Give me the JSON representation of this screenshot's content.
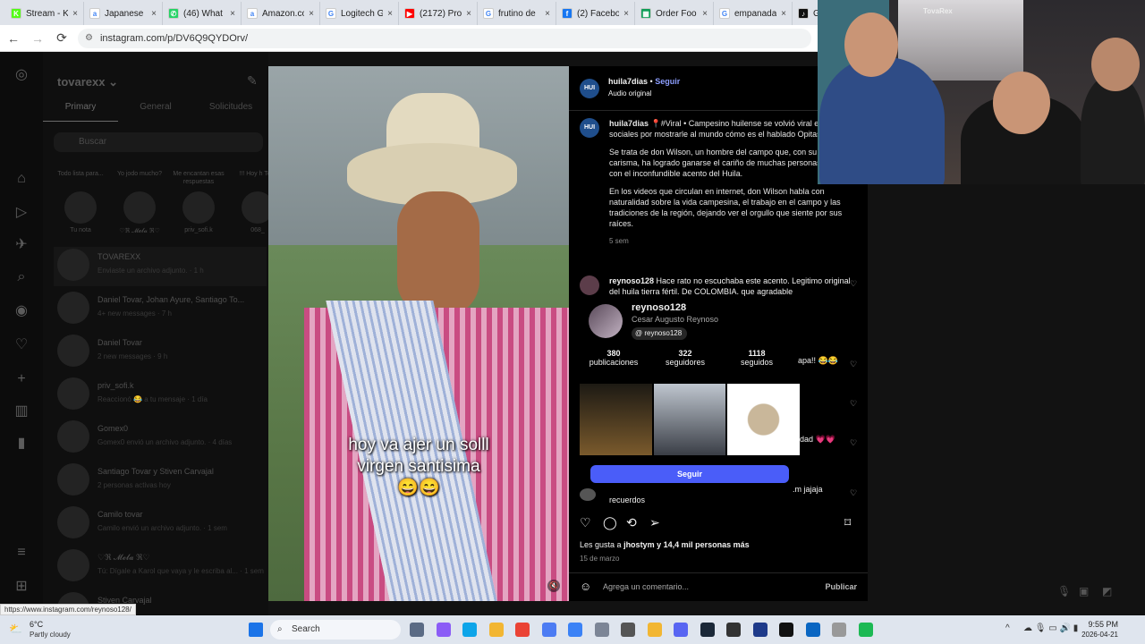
{
  "browser": {
    "tabs": [
      {
        "title": "Stream - K",
        "color": "#53fc18",
        "glyph": "K"
      },
      {
        "title": "Japanese",
        "color": "#ffffff",
        "glyph": "a"
      },
      {
        "title": "(46) What",
        "color": "#25d366",
        "glyph": "✆"
      },
      {
        "title": "Amazon.co",
        "color": "#ffffff",
        "glyph": "a"
      },
      {
        "title": "Logitech G",
        "color": "#ffffff",
        "glyph": "G"
      },
      {
        "title": "(2172) Pro",
        "color": "#ff0000",
        "glyph": "▶"
      },
      {
        "title": "frutino de",
        "color": "#ffffff",
        "glyph": "G"
      },
      {
        "title": "(2) Facebo",
        "color": "#1877f2",
        "glyph": "f"
      },
      {
        "title": "Order Foo",
        "color": "#0f9d58",
        "glyph": "▦"
      },
      {
        "title": "empanada",
        "color": "#ffffff",
        "glyph": "G"
      },
      {
        "title": "Gust",
        "color": "#111111",
        "glyph": "♪"
      }
    ],
    "url": "instagram.com/p/DV6Q9QYDOrv/",
    "status_url": "https://www.instagram.com/reynoso128/"
  },
  "dm": {
    "username": "tovarexx",
    "tabs": [
      "Primary",
      "General",
      "Solicitudes"
    ],
    "search_placeholder": "Buscar",
    "notes": [
      {
        "bubble": "Todo lista para...",
        "name": "Tu nota"
      },
      {
        "bubble": "Yo jodo mucho?",
        "name": "♡ℜ 𝓜𝓮𝓵𝓪 ℜ♡"
      },
      {
        "bubble": "Me encantan esas respuestas",
        "name": "priv_sofi.k"
      },
      {
        "bubble": "!!! Hoy h Tom",
        "name": "068_"
      }
    ],
    "threads": [
      {
        "name": "TOVAREXX",
        "sub": "Enviaste un archivo adjunto. · 1 h"
      },
      {
        "name": "Daniel Tovar, Johan Ayure, Santiago To...",
        "sub": "4+ new messages · 7 h"
      },
      {
        "name": "Daniel Tovar",
        "sub": "2 new messages · 9 h"
      },
      {
        "name": "priv_sofi.k",
        "sub": "Reaccionó 😂 a tu mensaje · 1 día"
      },
      {
        "name": "Gomex0",
        "sub": "Gomex0 envió un archivo adjunto. · 4 días"
      },
      {
        "name": "Santiago Tovar y Stiven Carvajal",
        "sub": "2 personas activas hoy"
      },
      {
        "name": "Camilo tovar",
        "sub": "Camilo envió un archivo adjunto. · 1 sem"
      },
      {
        "name": "♡ℜ 𝓜𝓮𝓵𝓪 ℜ♡",
        "sub": "Tú: Dígale a Karol que vaya y le escriba al... · 1 sem"
      },
      {
        "name": "Stiven Carvajal",
        "sub": ""
      }
    ]
  },
  "post": {
    "author": "huila7dias",
    "follow": "Seguir",
    "audio": "Audio original",
    "caption_title": "📍#Viral • Campesino huilense se volvió viral en redes sociales por mostrarle al mundo cómo es el hablado Opitas",
    "caption_p2": "Se trata de don Wilson, un hombre del campo que, con su sencillez y carisma, ha logrado ganarse el cariño de muchas personas por hablar con el inconfundible acento del Huila.",
    "caption_p3": "En los videos que circulan en internet, don Wilson habla con naturalidad sobre la vida campesina, el trabajo en el campo y las tradiciones de la región, dejando ver el orgullo que siente por sus raíces.",
    "caption_time": "5 sem",
    "video_caption": [
      "hoy va ajer un solll",
      "virgen santisima",
      "😄😄"
    ],
    "logo_text": "HUI",
    "comment1_user": "reynoso128",
    "comment1_text": "Hace rato no escuchaba este acento. Legitimo original del huila tierra fértil. De COLOMBIA. que agradable",
    "partial_comments": [
      "apa!! 😂😂",
      "idad 💗💗",
      ".m jajaja",
      "recuerdos"
    ],
    "likes_prefix": "Les gusta a",
    "likes_user": "jhostym",
    "likes_rest": "y 14,4 mil personas más",
    "date": "15 de marzo",
    "comment_placeholder": "Agrega un comentario...",
    "publish": "Publicar"
  },
  "hovercard": {
    "username": "reynoso128",
    "fullname": "Cesar Augusto Reynoso",
    "threads_handle": "reynoso128",
    "stats": [
      {
        "value": "380",
        "label": "publicaciones"
      },
      {
        "value": "322",
        "label": "seguidores"
      },
      {
        "value": "1118",
        "label": "seguidos"
      }
    ],
    "follow_button": "Seguir"
  },
  "webcam": {
    "overlay_text": "TovaRex"
  },
  "taskbar": {
    "weather_temp": "6°C",
    "weather_desc": "Partly cloudy",
    "search": "Search",
    "time": "9:55 PM",
    "date": "2026-04-21"
  }
}
